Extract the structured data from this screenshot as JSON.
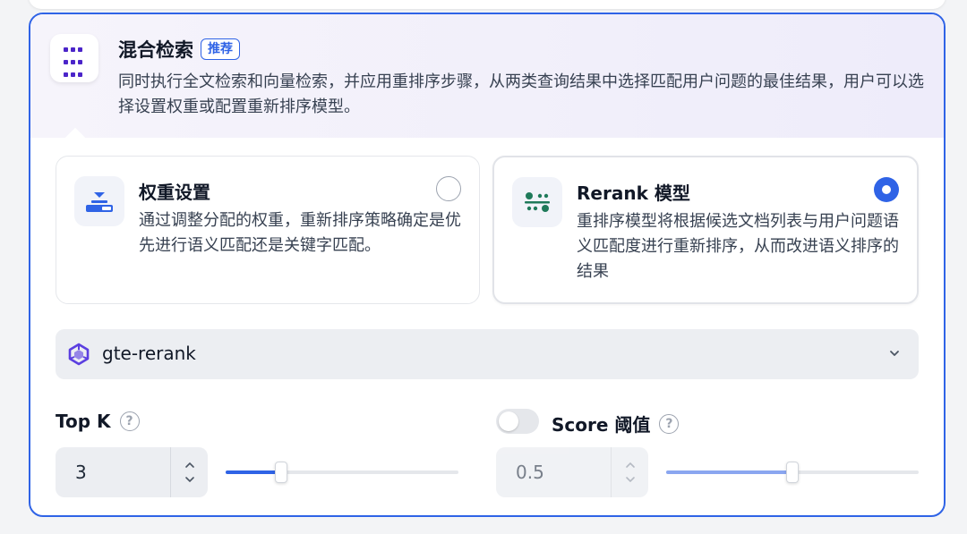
{
  "hybrid": {
    "title": "混合检索",
    "badge": "推荐",
    "description": "同时执行全文检索和向量检索，并应用重排序步骤，从两类查询结果中选择匹配用户问题的最佳结果，用户可以选择设置权重或配置重新排序模型。"
  },
  "options": [
    {
      "title": "权重设置",
      "description": "通过调整分配的权重，重新排序策略确定是优先进行语义匹配还是关键字匹配。",
      "selected": false
    },
    {
      "title": "Rerank 模型",
      "description": "重排序模型将根据候选文档列表与用户问题语义匹配度进行重新排序，从而改进语义排序的结果",
      "selected": true
    }
  ],
  "model_select": {
    "value": "gte-rerank"
  },
  "top_k": {
    "label": "Top K",
    "value": "3",
    "slider_fraction": 0.24
  },
  "score_threshold": {
    "label": "Score 阈值",
    "value": "0.5",
    "enabled": false,
    "slider_fraction": 0.5
  },
  "colors": {
    "accent": "#2f63e6",
    "icon_purple": "#4b24c9",
    "icon_green": "#1f7a5a"
  }
}
